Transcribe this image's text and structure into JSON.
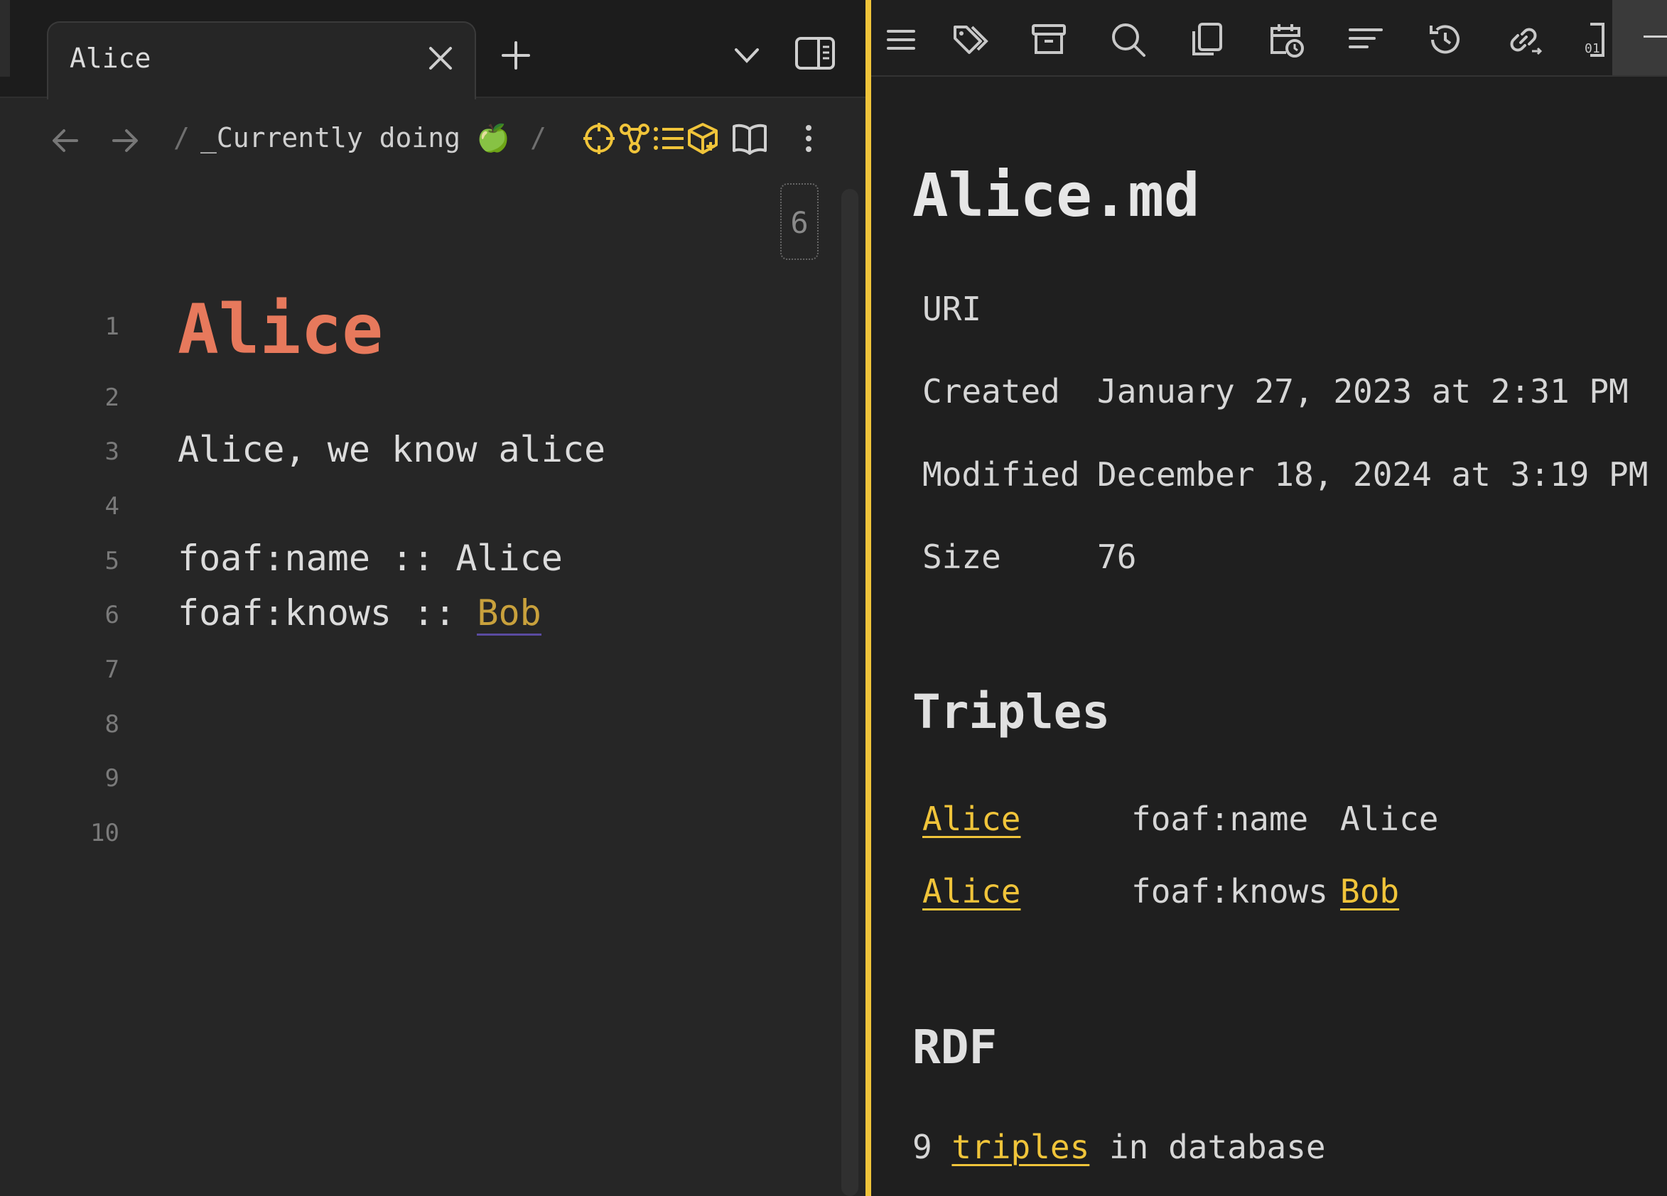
{
  "colors": {
    "accent": "#f0c43a",
    "heading": "#e7795c",
    "link": "#c9a13c"
  },
  "tab": {
    "title": "Alice"
  },
  "breadcrumb": {
    "sep1": "/",
    "folder": "_Currently doing 🍏",
    "sep2": "/"
  },
  "editor": {
    "fold_count": "6",
    "line_numbers": [
      "1",
      "2",
      "3",
      "4",
      "5",
      "6",
      "7",
      "8",
      "9",
      "10"
    ],
    "heading": "Alice",
    "line3": "Alice, we know alice",
    "line5": "foaf:name :: Alice",
    "line6_prefix": "foaf:knows :: ",
    "line6_link": "Bob"
  },
  "toolbar_icons": [
    "menu-icon",
    "tags-icon",
    "archive-icon",
    "search-icon",
    "copy-icon",
    "calendar-clock-icon",
    "outline-icon",
    "history-icon",
    "link-arrow-icon",
    "binary-file-icon"
  ],
  "panel": {
    "file_title": "Alice.md",
    "meta": [
      {
        "label": "URI",
        "value": ""
      },
      {
        "label": "Created",
        "value": "January 27, 2023 at 2:31 PM"
      },
      {
        "label": "Modified",
        "value": "December 18, 2024 at 3:19 PM"
      },
      {
        "label": "Size",
        "value": "76"
      }
    ],
    "triples_heading": "Triples",
    "triples": [
      {
        "subject": "Alice",
        "predicate": "foaf:name",
        "object": "Alice",
        "object_is_link": false
      },
      {
        "subject": "Alice",
        "predicate": "foaf:knows",
        "object": "Bob",
        "object_is_link": true
      }
    ],
    "rdf_heading": "RDF",
    "rdf_count": "9",
    "rdf_link": "triples",
    "rdf_suffix": "in database"
  }
}
